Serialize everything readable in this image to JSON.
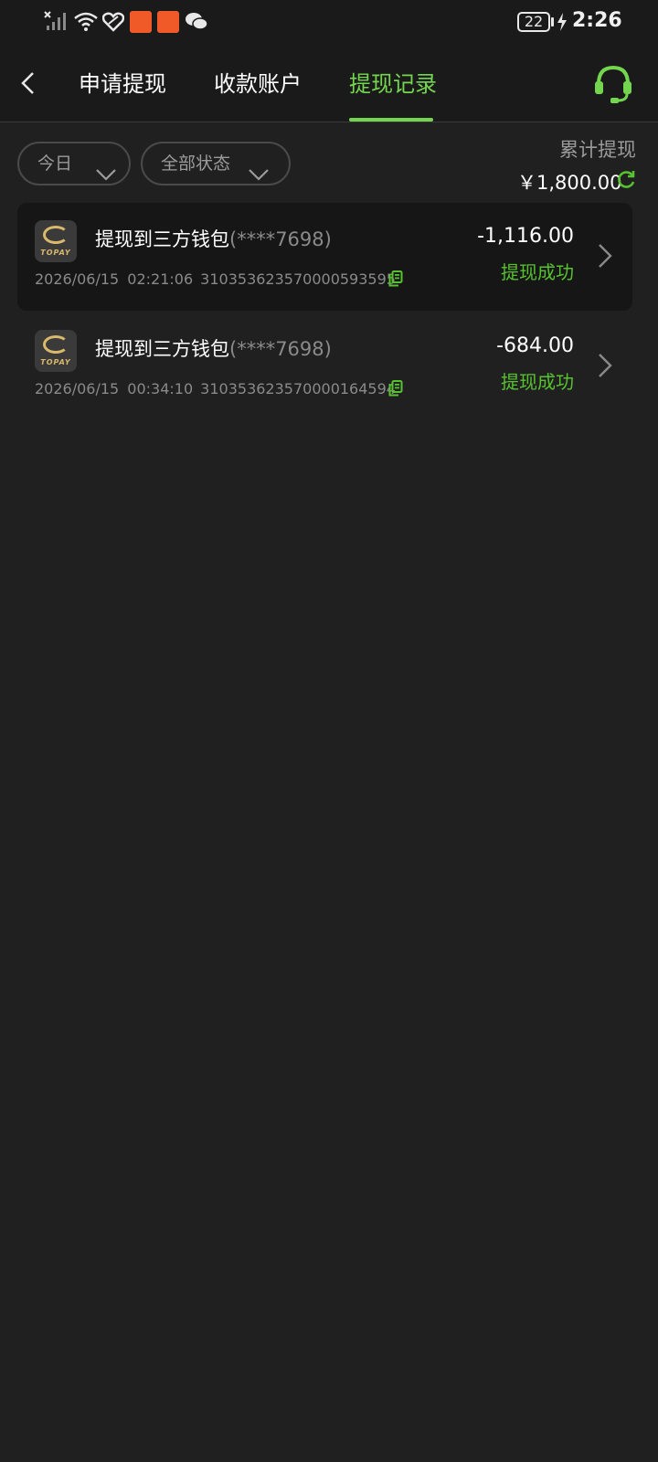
{
  "status_bar": {
    "battery": "22",
    "time": "2:26",
    "icons": [
      "no-signal-icon",
      "wifi-icon",
      "heart-app-icon",
      "kuaishou-app-icon",
      "kuaishou-app-icon",
      "wechat-icon",
      "battery-icon",
      "charging-bolt-icon"
    ]
  },
  "nav": {
    "tabs": [
      {
        "label": "申请提现",
        "active": false
      },
      {
        "label": "收款账户",
        "active": false
      },
      {
        "label": "提现记录",
        "active": true
      }
    ],
    "accent_color": "#74d64f"
  },
  "filters": {
    "date": "今日",
    "status": "全部状态"
  },
  "summary": {
    "label": "累计提现",
    "amount": "￥1,800.00"
  },
  "records": [
    {
      "logo_text": "TOPAY",
      "title": "提现到三方钱包",
      "account_masked": "(****7698)",
      "datetime": "2026/06/15 02:21:06",
      "order_no": "310353623570000593595",
      "amount": "-1,116.00",
      "status": "提现成功"
    },
    {
      "logo_text": "TOPAY",
      "title": "提现到三方钱包",
      "account_masked": "(****7698)",
      "datetime": "2026/06/15 00:34:10",
      "order_no": "310353623570000164594",
      "amount": "-684.00",
      "status": "提现成功"
    }
  ],
  "colors": {
    "background": "#202020",
    "success": "#56c22f",
    "muted": "#8a8a8a"
  }
}
